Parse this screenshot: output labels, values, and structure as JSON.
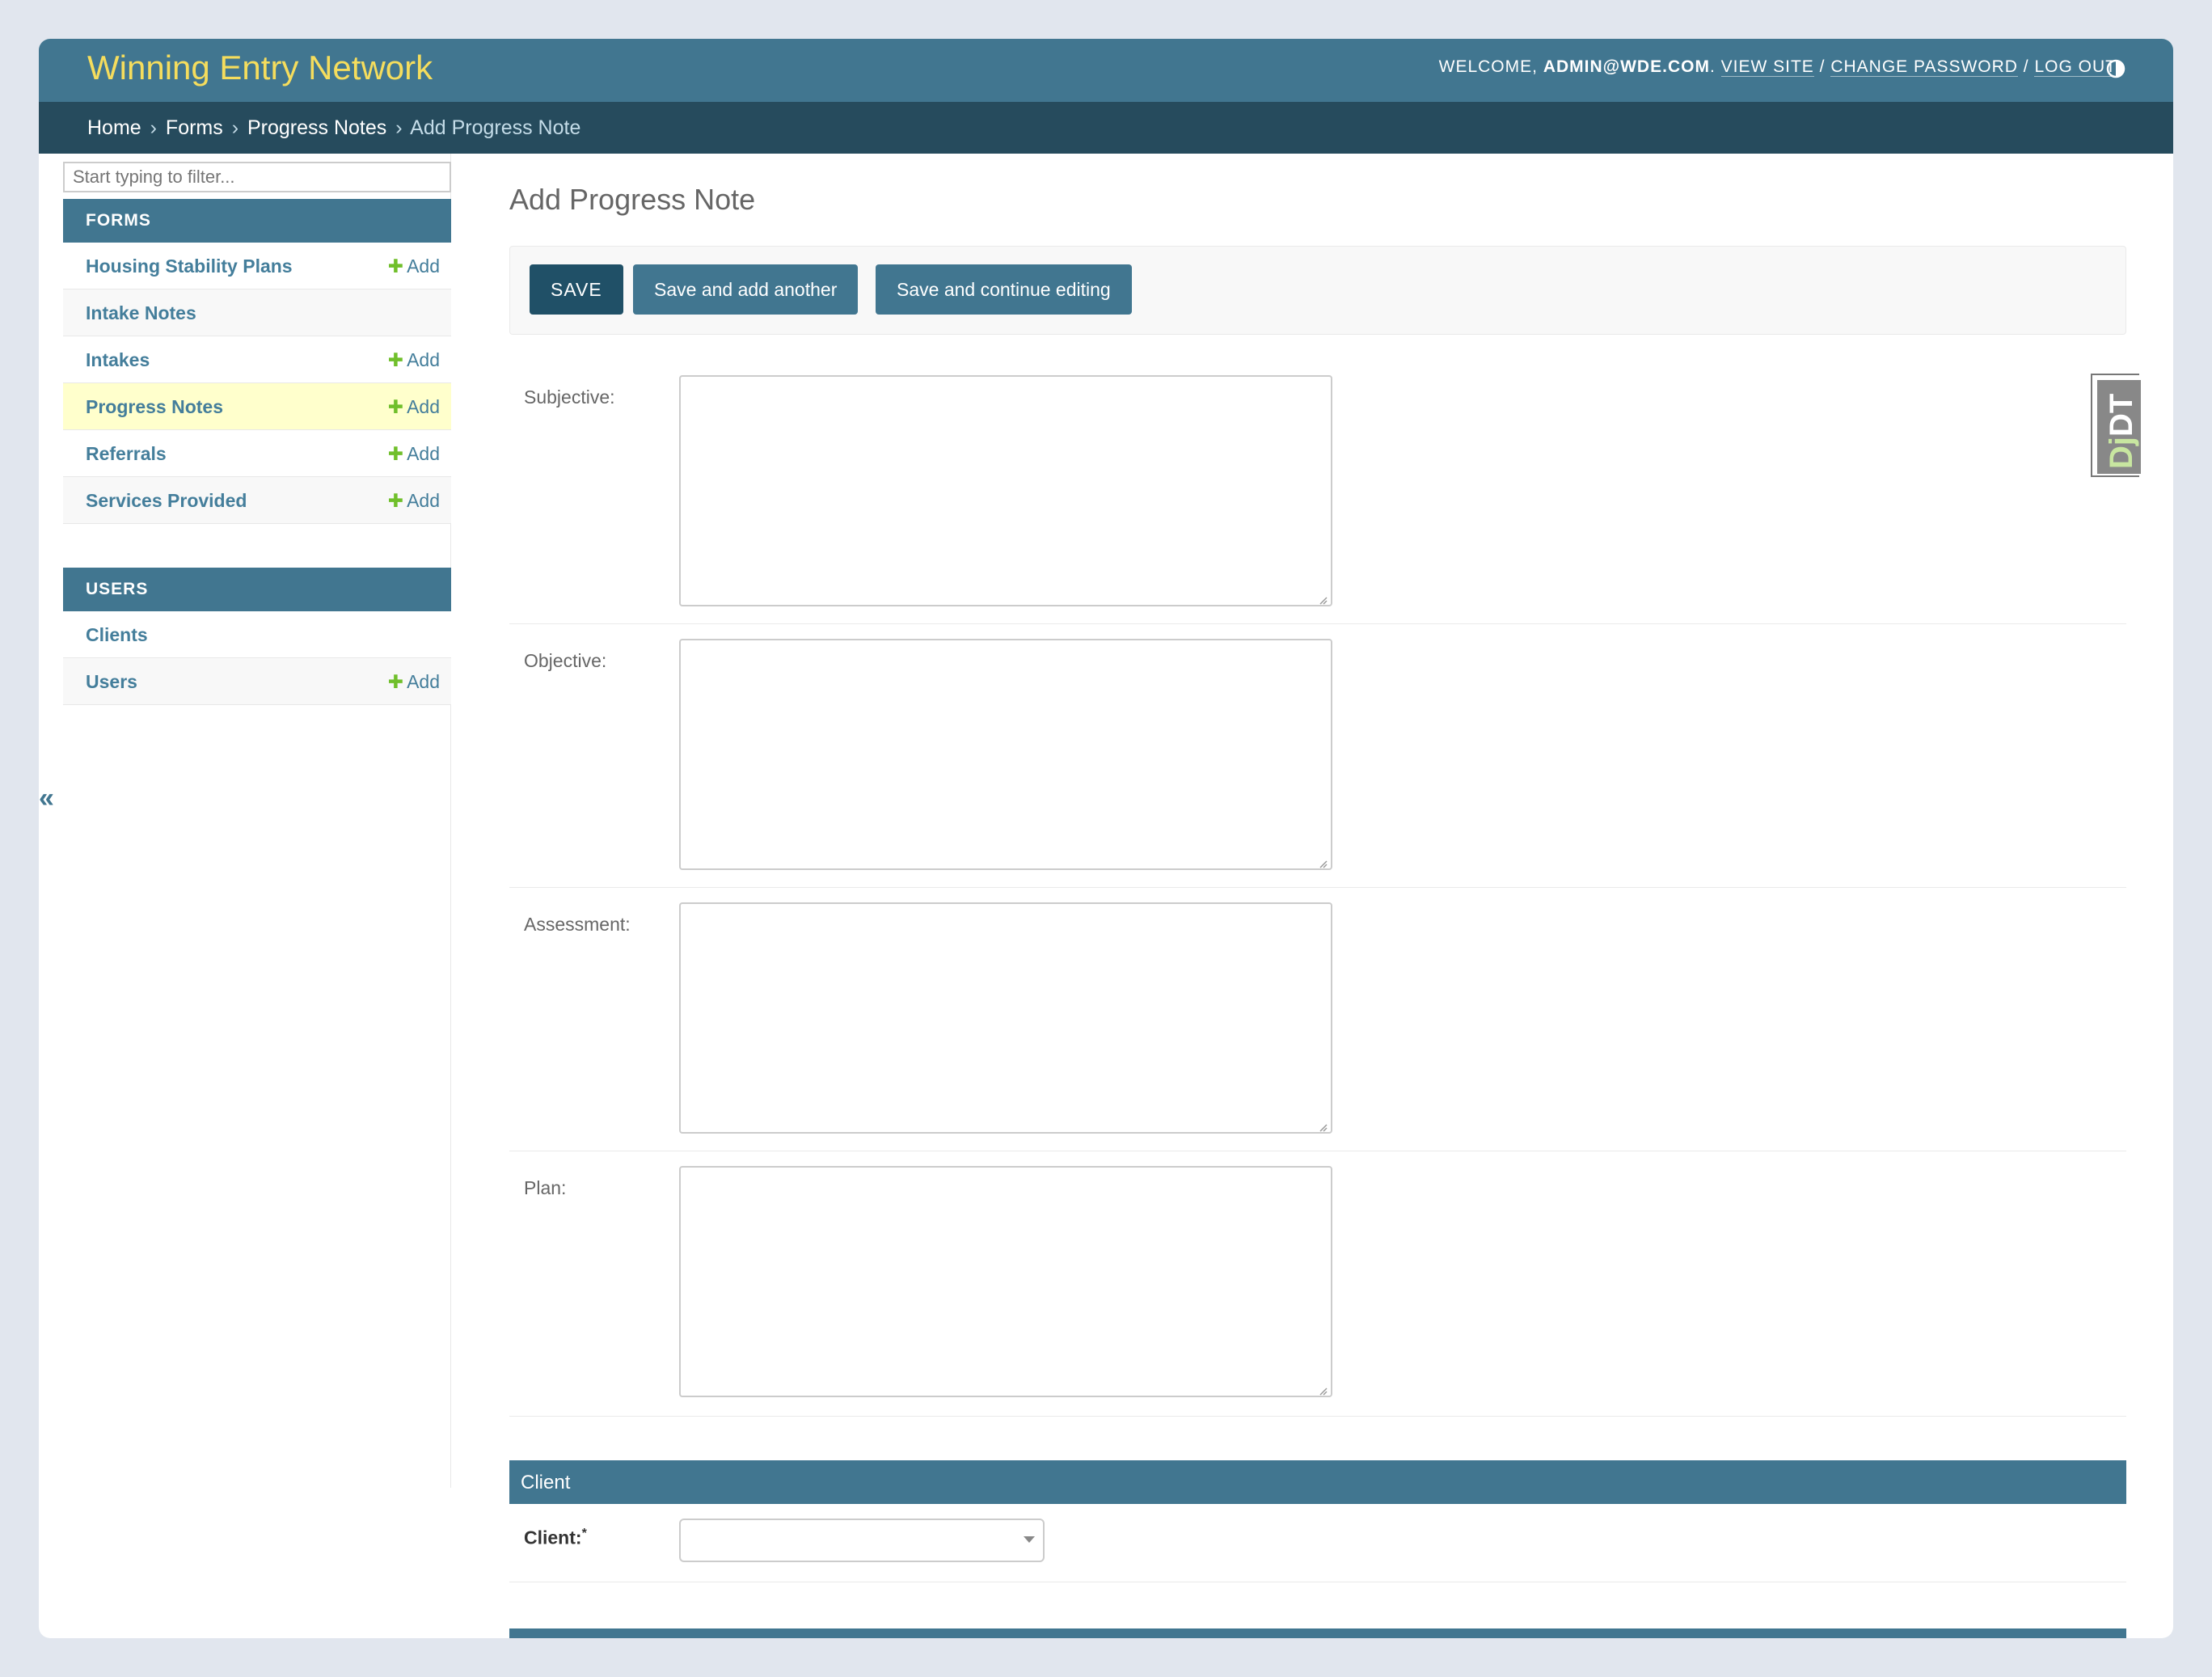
{
  "header": {
    "brand": "Winning Entry Network",
    "welcome": "WELCOME,",
    "user": "ADMIN@WDE.COM",
    "view_site": "VIEW SITE",
    "change_password": "CHANGE PASSWORD",
    "log_out": "LOG OUT",
    "separator": " / "
  },
  "breadcrumbs": {
    "items": [
      "Home",
      "Forms",
      "Progress Notes"
    ],
    "current": "Add Progress Note",
    "sep": "›"
  },
  "sidebar": {
    "filter_placeholder": "Start typing to filter...",
    "add_label": "Add",
    "forms_heading": "FORMS",
    "forms": [
      {
        "label": "Housing Stability Plans",
        "has_add": true
      },
      {
        "label": "Intake Notes",
        "has_add": false
      },
      {
        "label": "Intakes",
        "has_add": true
      },
      {
        "label": "Progress Notes",
        "has_add": true,
        "current": true
      },
      {
        "label": "Referrals",
        "has_add": true
      },
      {
        "label": "Services Provided",
        "has_add": true
      }
    ],
    "users_heading": "USERS",
    "users": [
      {
        "label": "Clients",
        "has_add": false
      },
      {
        "label": "Users",
        "has_add": true
      }
    ],
    "collapse": "«"
  },
  "main": {
    "title": "Add Progress Note",
    "buttons": {
      "save": "SAVE",
      "save_add_another": "Save and add another",
      "save_continue": "Save and continue editing"
    },
    "fields": [
      {
        "label": "Subjective:",
        "value": ""
      },
      {
        "label": "Objective:",
        "value": ""
      },
      {
        "label": "Assessment:",
        "value": ""
      },
      {
        "label": "Plan:",
        "value": ""
      }
    ],
    "client_fieldset": "Client",
    "client_label": "Client:",
    "client_required_mark": "*",
    "client_selected": ""
  },
  "djdt": {
    "label_a": "Dj",
    "label_b": "DT"
  },
  "colors": {
    "header": "#417690",
    "breadcrumbs": "#264b5d",
    "brand": "#f5dd5d",
    "link": "#447e9b",
    "add_plus": "#70bf2b",
    "current_row": "#ffffcc",
    "save_button": "#205067"
  },
  "icons": {
    "theme_toggle": "half-circle-icon",
    "add": "plus-icon",
    "select_caret": "chevron-down-icon"
  }
}
